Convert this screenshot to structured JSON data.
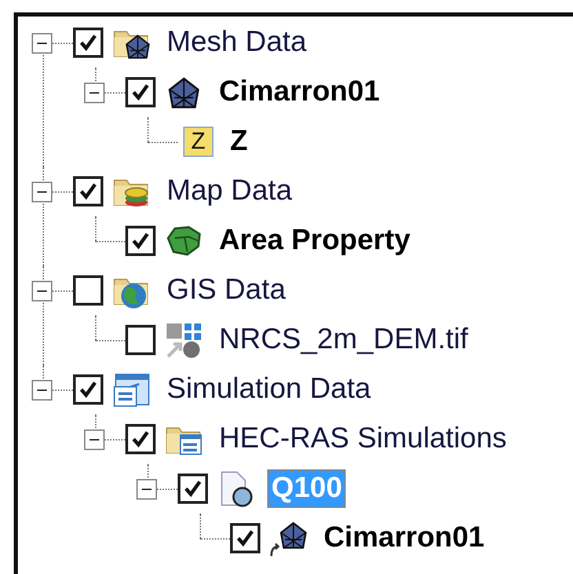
{
  "tree": [
    {
      "label": "Mesh Data",
      "kind": "mesh-folder",
      "checked": true,
      "expanded": true,
      "bold": false,
      "selected": false,
      "children": [
        {
          "label": "Cimarron01",
          "kind": "mesh",
          "checked": true,
          "expanded": true,
          "bold": true,
          "selected": false,
          "children": [
            {
              "label": "Z",
              "kind": "field",
              "badge": "Z",
              "bold": true,
              "selected": false
            }
          ]
        }
      ]
    },
    {
      "label": "Map Data",
      "kind": "map-folder",
      "checked": true,
      "expanded": true,
      "bold": false,
      "selected": false,
      "children": [
        {
          "label": "Area Property",
          "kind": "coverage",
          "checked": true,
          "bold": true,
          "selected": false
        }
      ]
    },
    {
      "label": "GIS Data",
      "kind": "gis-folder",
      "checked": false,
      "expanded": true,
      "bold": false,
      "selected": false,
      "children": [
        {
          "label": "NRCS_2m_DEM.tif",
          "kind": "raster",
          "checked": false,
          "bold": false,
          "selected": false
        }
      ]
    },
    {
      "label": "Simulation Data",
      "kind": "sim-folder",
      "checked": true,
      "expanded": true,
      "bold": false,
      "selected": false,
      "children": [
        {
          "label": "HEC-RAS Simulations",
          "kind": "hecras-folder",
          "checked": true,
          "expanded": true,
          "bold": false,
          "selected": false,
          "children": [
            {
              "label": "Q100",
              "kind": "plan",
              "checked": true,
              "expanded": true,
              "bold": true,
              "selected": true,
              "children": [
                {
                  "label": "Cimarron01",
                  "kind": "mesh-link",
                  "checked": true,
                  "bold": true,
                  "selected": false
                }
              ]
            }
          ]
        }
      ]
    }
  ]
}
